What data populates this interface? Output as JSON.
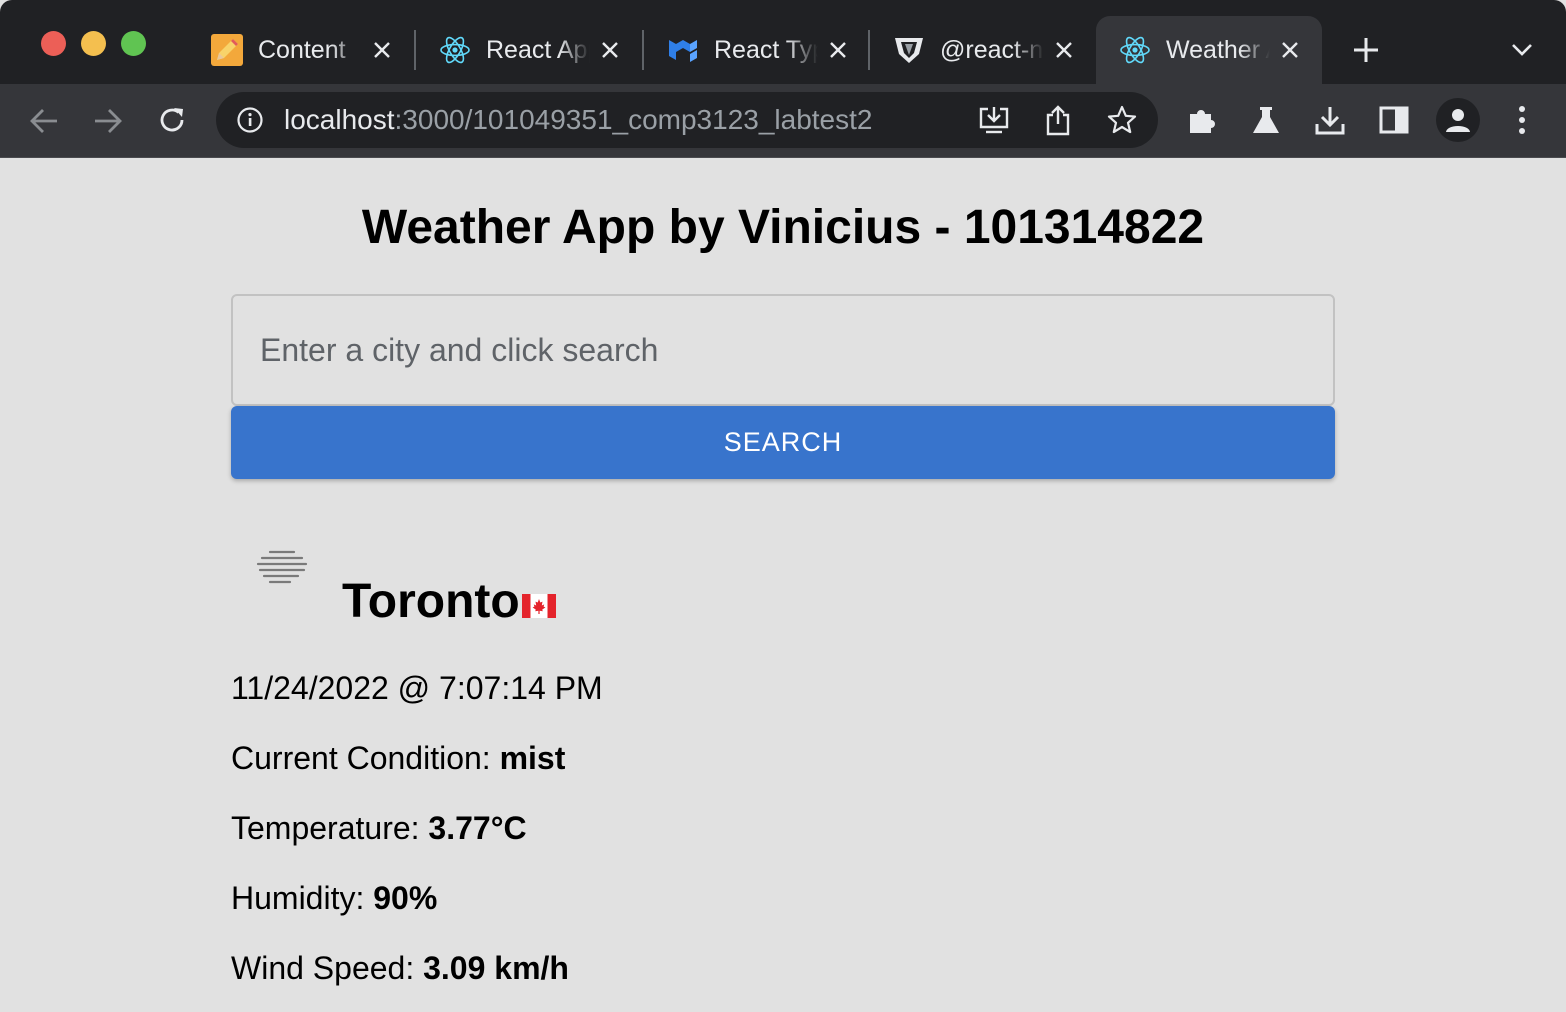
{
  "tabs": [
    {
      "label": "Content",
      "icon": "pencil-icon"
    },
    {
      "label": "React App",
      "icon": "react-icon"
    },
    {
      "label": "React Typescript",
      "icon": "mui-icon"
    },
    {
      "label": "@react-navigation",
      "icon": "shield-icon"
    },
    {
      "label": "Weather App",
      "icon": "react-icon",
      "active": true
    }
  ],
  "address_bar": {
    "host": "localhost",
    "path": ":3000/101049351_comp3123_labtest2"
  },
  "app": {
    "title": "Weather App by Vinicius - 101314822",
    "search_placeholder": "Enter a city and click search",
    "search_button": "SEARCH"
  },
  "weather": {
    "icon": "mist-icon",
    "city": "Toronto",
    "country_flag": "canada-flag",
    "datetime": "11/24/2022 @ 7:07:14 PM",
    "condition_label": "Current Condition: ",
    "condition_value": "mist",
    "temperature_label": "Temperature: ",
    "temperature_value": "3.77°C",
    "humidity_label": "Humidity: ",
    "humidity_value": "90%",
    "wind_label": "Wind Speed: ",
    "wind_value": "3.09 km/h"
  },
  "colors": {
    "accent": "#3874cc",
    "page_bg": "#e1e1e1",
    "chrome_dark": "#202124",
    "chrome_toolbar": "#35363a"
  }
}
